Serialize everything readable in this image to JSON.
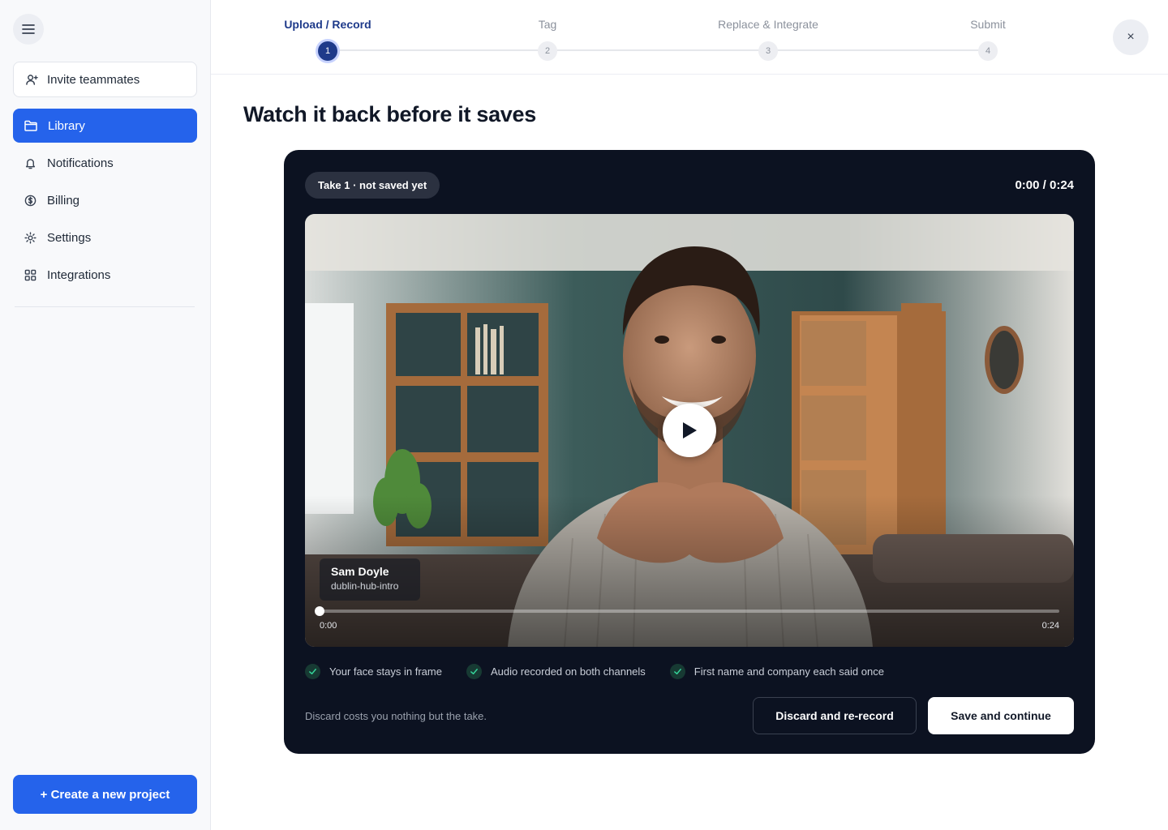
{
  "sidebar": {
    "menu_icon": "hamburger-icon",
    "invite_label": "Invite teammates",
    "nav_items": [
      {
        "label": "Library",
        "icon": "folder-icon",
        "active": true
      },
      {
        "label": "Notifications",
        "icon": "bell-icon",
        "active": false
      },
      {
        "label": "Billing",
        "icon": "dollar-circle-icon",
        "active": false
      },
      {
        "label": "Settings",
        "icon": "gear-icon",
        "active": false
      },
      {
        "label": "Integrations",
        "icon": "grid-icon",
        "active": false
      }
    ],
    "create_label": "+ Create a new project"
  },
  "stepper": {
    "steps": [
      {
        "label": "Upload / Record",
        "number": "1",
        "active": true
      },
      {
        "label": "Tag",
        "number": "2",
        "active": false
      },
      {
        "label": "Replace & Integrate",
        "number": "3",
        "active": false
      },
      {
        "label": "Submit",
        "number": "4",
        "active": false
      }
    ],
    "close_symbol": "×"
  },
  "page": {
    "title": "Watch it back before it saves"
  },
  "player": {
    "take_badge": "Take 1 · not saved yet",
    "time_readout": "0:00 / 0:24",
    "speaker_name": "Sam Doyle",
    "clip_name": "dublin-hub-intro",
    "time_start": "0:00",
    "time_end": "0:24",
    "progress": 0
  },
  "checks": [
    "Your face stays in frame",
    "Audio recorded on both channels",
    "First name and company each said once"
  ],
  "footer": {
    "hint": "Discard costs you nothing but the take.",
    "discard_label": "Discard and re-record",
    "save_label": "Save and continue"
  },
  "colors": {
    "accent": "#2563eb",
    "step_active": "#1e3a8a",
    "card_bg": "#0c1221",
    "check_green": "#34d399"
  }
}
